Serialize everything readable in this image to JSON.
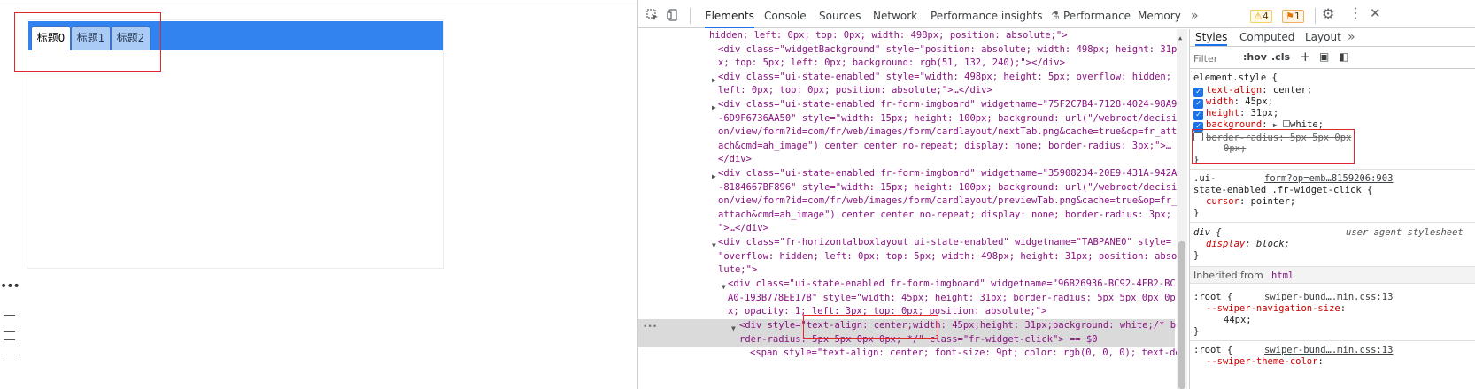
{
  "page": {
    "tabs": [
      "标题0",
      "标题1",
      "标题2"
    ],
    "active_tab": 0,
    "more_dots": "•••"
  },
  "devtools": {
    "tabs": [
      "Elements",
      "Console",
      "Sources",
      "Network",
      "Performance insights",
      "Performance",
      "Memory"
    ],
    "active_tab": "Elements",
    "more": "»",
    "warnings": "4",
    "issues": "1",
    "elements_lines": [
      {
        "text": "hidden; left: 0px; top: 0px; width: 498px; position: absolute;\">"
      },
      {
        "text": "<div class=\"widgetBackground\" style=\"position: absolute; width: 498px; height: 31p"
      },
      {
        "text": "x; top: 5px; left: 0px; background: rgb(51, 132, 240);\"></div>"
      },
      {
        "text": "<div class=\"ui-state-enabled\" style=\"width: 498px; height: 5px; overflow: hidden;"
      },
      {
        "text": "left: 0px; top: 0px; position: absolute;\">…</div>"
      },
      {
        "text": "<div class=\"ui-state-enabled fr-form-imgboard\" widgetname=\"75F2C7B4-7128-4024-98A9"
      },
      {
        "text": "-6D9F6736AA50\" style=\"width: 15px; height: 100px; background: url(\"/webroot/decisi"
      },
      {
        "text": "on/view/form?id=com/fr/web/images/form/cardlayout/nextTab.png&cache=true&op=fr_att"
      },
      {
        "text": "ach&cmd=ah_image\") center center no-repeat; display: none; border-radius: 3px;\">…"
      },
      {
        "text": "</div>"
      },
      {
        "text": "<div class=\"ui-state-enabled fr-form-imgboard\" widgetname=\"35908234-20E9-431A-942A"
      },
      {
        "text": "-8184667BF896\" style=\"width: 15px; height: 100px; background: url(\"/webroot/decisi"
      },
      {
        "text": "on/view/form?id=com/fr/web/images/form/cardlayout/previewTab.png&cache=true&op=fr_"
      },
      {
        "text": "attach&cmd=ah_image\") center center no-repeat; display: none; border-radius: 3px;"
      },
      {
        "text": "\">…</div>"
      },
      {
        "text": "<div class=\"fr-horizontalboxlayout ui-state-enabled\" widgetname=\"TABPANE0\" style="
      },
      {
        "text": "\"overflow: hidden; left: 0px; top: 5px; width: 498px; height: 31px; position: abso"
      },
      {
        "text": "lute;\">"
      },
      {
        "text": "<div class=\"ui-state-enabled fr-form-imgboard\" widgetname=\"96B26936-BC92-4FB2-BC"
      },
      {
        "text": "A0-193B778EE17B\" style=\"width: 45px; height: 31px; border-radius: 5px 5px 0px 0p"
      },
      {
        "text": "x; opacity: 1; left: 3px; top: 0px; position: absolute;\">"
      },
      {
        "text": "<div style=\"text-align: center;width: 45px;height: 31px;background: white;/* bo"
      },
      {
        "text": "rder-radius: 5px 5px 0px 0px; */\" class=\"fr-widget-click\"> == $0"
      },
      {
        "text": "<span style=\"text-align: center; font-size: 9pt; color: rgb(0, 0, 0); text-de"
      }
    ],
    "styles_tabs": [
      "Styles",
      "Computed",
      "Layout"
    ],
    "filter_placeholder": "Filter",
    "hov": ":hov",
    "cls": ".cls",
    "element_style": {
      "selector": "element.style {",
      "props": [
        {
          "name": "text-align",
          "value": "center;",
          "checked": true
        },
        {
          "name": "width",
          "value": "45px;",
          "checked": true
        },
        {
          "name": "height",
          "value": "31px;",
          "checked": true
        },
        {
          "name": "background",
          "value": "white;",
          "checked": true
        },
        {
          "name": "border-radius",
          "value": "5px 5px 0px",
          "checked": false
        }
      ],
      "wrap_value": "0px;",
      "close": "}"
    },
    "rule2": {
      "selector_a": ".ui-",
      "source": "form?op=emb…8159206:903",
      "selector_b": "state-enabled .fr-widget-click {",
      "prop": "cursor",
      "value": "pointer;",
      "close": "}"
    },
    "rule3": {
      "selector": "div {",
      "source": "user agent stylesheet",
      "prop": "display",
      "value": "block;",
      "close": "}"
    },
    "inherited_label": "Inherited from",
    "inherited_tag": "html",
    "rule4": {
      "selector": ":root {",
      "source": "swiper-bund….min.css:13",
      "prop": "--swiper-navigation-size",
      "value": "44px;",
      "close": "}"
    },
    "rule5": {
      "selector": ":root {",
      "source": "swiper-bund….min.css:13",
      "prop": "--swiper-theme-color"
    }
  }
}
